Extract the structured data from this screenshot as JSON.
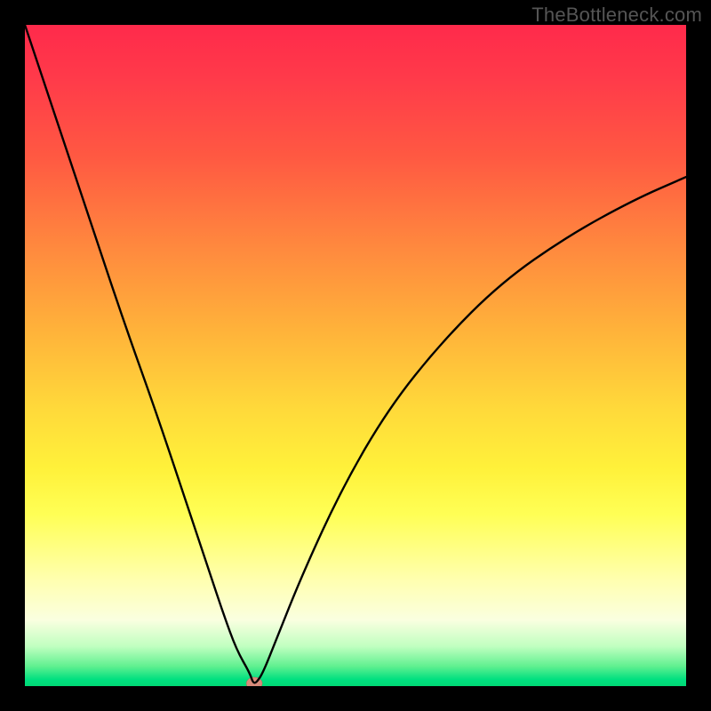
{
  "watermark": "TheBottleneck.com",
  "chart_data": {
    "type": "line",
    "title": "",
    "xlabel": "",
    "ylabel": "",
    "xlim": [
      0,
      1
    ],
    "ylim": [
      0,
      1
    ],
    "series": [
      {
        "name": "bottleneck-curve",
        "x": [
          0.0,
          0.05,
          0.1,
          0.15,
          0.2,
          0.25,
          0.28,
          0.3,
          0.32,
          0.34,
          0.345,
          0.35,
          0.36,
          0.38,
          0.42,
          0.48,
          0.55,
          0.63,
          0.72,
          0.82,
          0.92,
          1.0
        ],
        "y": [
          1.0,
          0.85,
          0.7,
          0.55,
          0.41,
          0.26,
          0.17,
          0.11,
          0.055,
          0.02,
          0.005,
          0.005,
          0.02,
          0.07,
          0.17,
          0.3,
          0.42,
          0.52,
          0.61,
          0.68,
          0.735,
          0.77
        ]
      }
    ],
    "marker": {
      "x": 0.347,
      "y": 0.0,
      "color": "#d88a7a"
    },
    "gradient_colors": {
      "top": "#ff2a4b",
      "mid": "#ffff55",
      "bottom": "#00d874"
    },
    "frame_color": "#000000"
  }
}
